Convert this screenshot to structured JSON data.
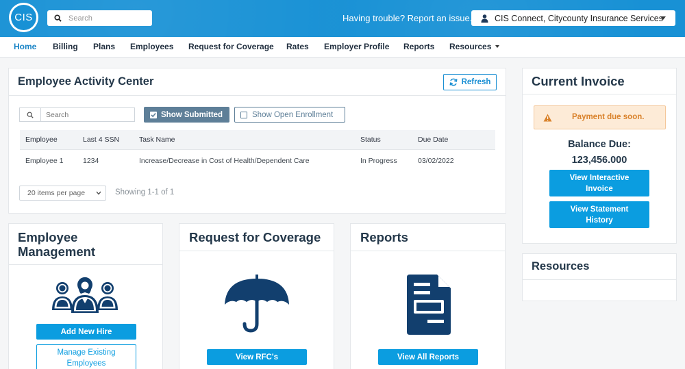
{
  "logo": {
    "text": "CIS"
  },
  "header": {
    "search_placeholder": "Search",
    "trouble_text": "Having trouble? Report an issue.",
    "account_label": "CIS Connect, Citycounty Insurance Services"
  },
  "nav": [
    "Home",
    "Billing",
    "Plans",
    "Employees",
    "Request for Coverage",
    "Rates",
    "Employer Profile",
    "Reports",
    "Resources"
  ],
  "activity": {
    "title": "Employee Activity Center",
    "refresh_label": "Refresh",
    "search_placeholder": "Search",
    "show_submitted_label": "Show Submitted",
    "show_open_enrollment_label": "Show Open Enrollment",
    "columns": [
      "Employee",
      "Last 4 SSN",
      "Task Name",
      "Status",
      "Due Date"
    ],
    "rows": [
      [
        "Employee 1",
        "1234",
        "Increase/Decrease in Cost of Health/Dependent Care",
        "In Progress",
        "03/02/2022"
      ]
    ],
    "page_size_label": "20 items per page",
    "showing_text": "Showing 1-1 of 1"
  },
  "employee_mgmt": {
    "title_line1": "Employee",
    "title_line2": "Management",
    "add_label": "Add New Hire",
    "manage_label_line1": "Manage Existing",
    "manage_label_line2": "Employees"
  },
  "rfc": {
    "title": "Request for Coverage",
    "button_label": "View RFC's"
  },
  "reports": {
    "title": "Reports",
    "button_label": "View All Reports"
  },
  "invoice": {
    "title": "Current Invoice",
    "alert": "Payment due soon.",
    "balance_label": "Balance Due:",
    "balance_value": "123,456.000",
    "interactive_line1": "View Interactive",
    "interactive_line2": "Invoice",
    "statement_line1": "View Statement",
    "statement_line2": "History"
  },
  "resources": {
    "title": "Resources"
  },
  "colors": {
    "brand_blue": "#1891d5",
    "button_blue": "#0b9de0",
    "navy_icon": "#123f6e",
    "alert_bg": "#fdebd7",
    "alert_text": "#d9822b"
  }
}
